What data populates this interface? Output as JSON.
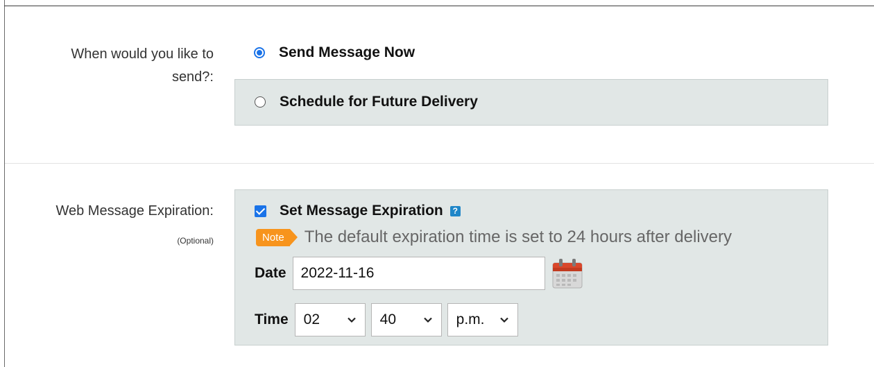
{
  "send_section": {
    "label": "When would you like to send?:",
    "options": [
      {
        "label": "Send Message Now",
        "selected": true
      },
      {
        "label": "Schedule for Future Delivery",
        "selected": false
      }
    ]
  },
  "expiration_section": {
    "label": "Web Message Expiration:",
    "optional_label": "(Optional)",
    "checkbox_label": "Set Message Expiration",
    "checkbox_checked": true,
    "help_icon": "question-icon",
    "note_badge": "Note",
    "note_text": "The default expiration time is set to 24 hours after delivery",
    "date_label": "Date",
    "date_value": "2022-11-16",
    "calendar_icon": "calendar-icon",
    "time_label": "Time",
    "hour_value": "02",
    "minute_value": "40",
    "ampm_value": "p.m."
  },
  "colors": {
    "accent": "#1a73e8",
    "panel": "#e1e7e6",
    "note": "#f7941d",
    "help": "#1f86c8"
  }
}
